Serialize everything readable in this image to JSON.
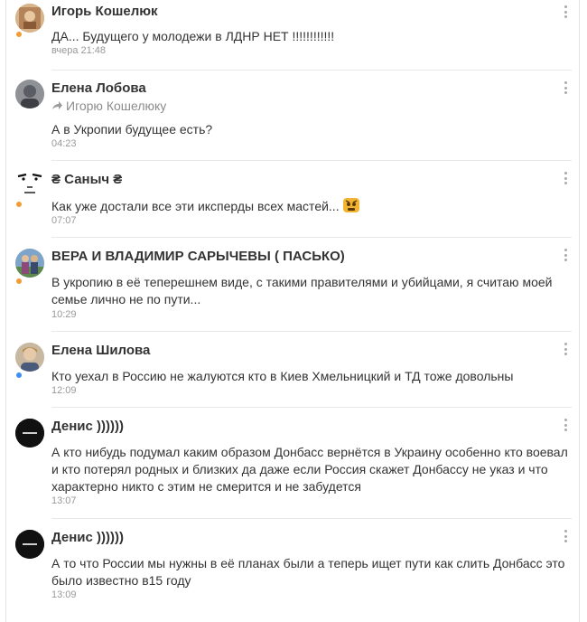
{
  "colors": {
    "status_orange": "#f39c33",
    "status_blue": "#3d8ff0"
  },
  "comments": [
    {
      "author": "Игорь Кошелюк",
      "text": "ДА... Будущего у молодежи в ЛДНР НЕТ !!!!!!!!!!!!",
      "time": "вчера 21:48",
      "status": "orange",
      "avatar_icon": "profile-photo"
    },
    {
      "author": "Елена Лобова",
      "reply_to": "Игорю Кошелюку",
      "text": "А в Укропии  будущее есть?",
      "time": "04:23",
      "status": "none",
      "avatar_icon": "profile-photo"
    },
    {
      "author": "₴ Саныч ₴",
      "text": "Как уже достали все эти иксперды всех мастей...",
      "emoji": "angry-face-emoji",
      "time": "07:07",
      "status": "orange",
      "avatar_icon": "drawn-face"
    },
    {
      "author": "ВЕРА И ВЛАДИМИР САРЫЧЕВЫ ( ПАСЬКО)",
      "text": "В укропию в её теперешнем виде, с такими правителями и убийцами, я считаю моей семье лично не по пути...",
      "time": "10:29",
      "status": "orange",
      "avatar_icon": "couple-photo"
    },
    {
      "author": "Елена Шилова",
      "text": "Кто уехал в Россию не жалуются кто в Киев Хмельницкий и ТД тоже довольны",
      "time": "12:09",
      "status": "blue",
      "avatar_icon": "profile-photo"
    },
    {
      "author": "Денис ))))))",
      "text": "А кто нибудь подумал каким образом Донбасс вернётся в Украину особенно кто воевал и кто потерял родных и близких да даже если Россия скажет Донбассу не указ и что характерно никто с этим не смерится и не забудется",
      "time": "13:07",
      "status": "none",
      "avatar_icon": "black-logo"
    },
    {
      "author": "Денис ))))))",
      "text": "А то что России мы нужны в её планах были а теперь ищет пути как слить Донбасс это было известно в15 году",
      "time": "13:09",
      "status": "none",
      "avatar_icon": "black-logo"
    }
  ]
}
